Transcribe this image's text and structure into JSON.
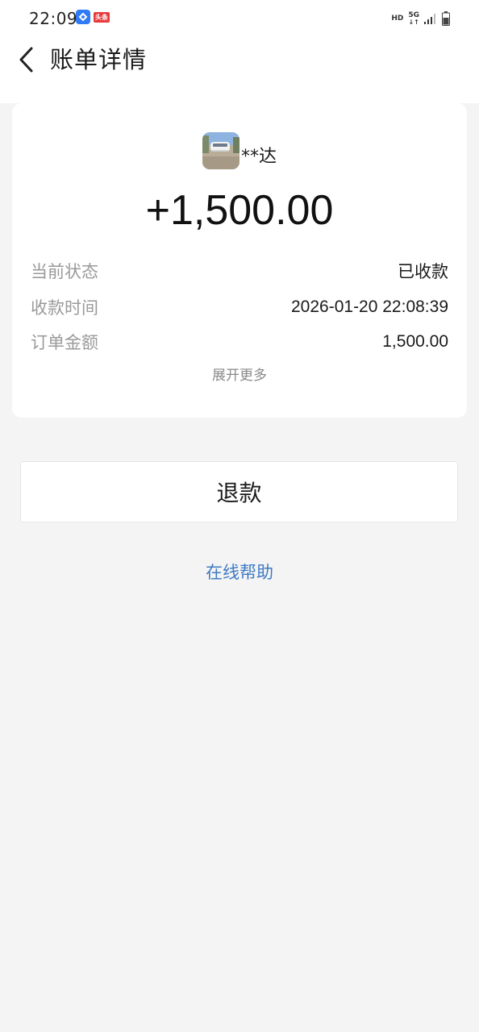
{
  "status_bar": {
    "time": "22:09",
    "app_badge": "头条",
    "hd": "HD",
    "network": "5G",
    "network_arrows": "↓↑"
  },
  "header": {
    "back_icon": "chevron-left-icon",
    "title": "账单详情"
  },
  "bill": {
    "payer_name": "**达",
    "amount": "+1,500.00",
    "details": [
      {
        "label": "当前状态",
        "value": "已收款"
      },
      {
        "label": "收款时间",
        "value": "2026-01-20 22:08:39"
      },
      {
        "label": "订单金额",
        "value": "1,500.00"
      }
    ],
    "expand_label": "展开更多"
  },
  "actions": {
    "refund_label": "退款",
    "help_label": "在线帮助"
  },
  "colors": {
    "background": "#f4f4f4",
    "card": "#ffffff",
    "link": "#3f7bc4",
    "label_gray": "#9a9a9a"
  }
}
